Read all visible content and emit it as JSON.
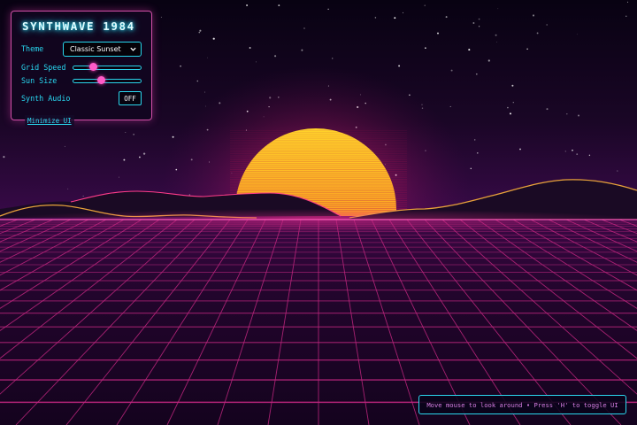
{
  "app": {
    "title": "SYNTHWAVE 1984"
  },
  "controls": {
    "theme": {
      "label": "Theme",
      "value": "Classic Sunset"
    },
    "grid_speed": {
      "label": "Grid Speed",
      "value": 0.3
    },
    "sun_size": {
      "label": "Sun Size",
      "value": 0.42
    },
    "synth_audio": {
      "label": "Synth Audio",
      "state": "OFF"
    },
    "minimize_label": "Minimize UI"
  },
  "hint": "Move mouse to look around • Press 'H' to toggle UI",
  "icons": {
    "theme_dropdown": "chevron-down-icon"
  },
  "colors": {
    "accent_cyan": "#2bd6ee",
    "accent_pink": "#ff4fc3",
    "grid": "#c0267f",
    "sun_top": "#ffd32a",
    "sun_bottom": "#ff2b6e",
    "sky_top": "#080212",
    "sky_bottom": "#3a0a4a",
    "ridge_gold": "#e8a23a"
  }
}
